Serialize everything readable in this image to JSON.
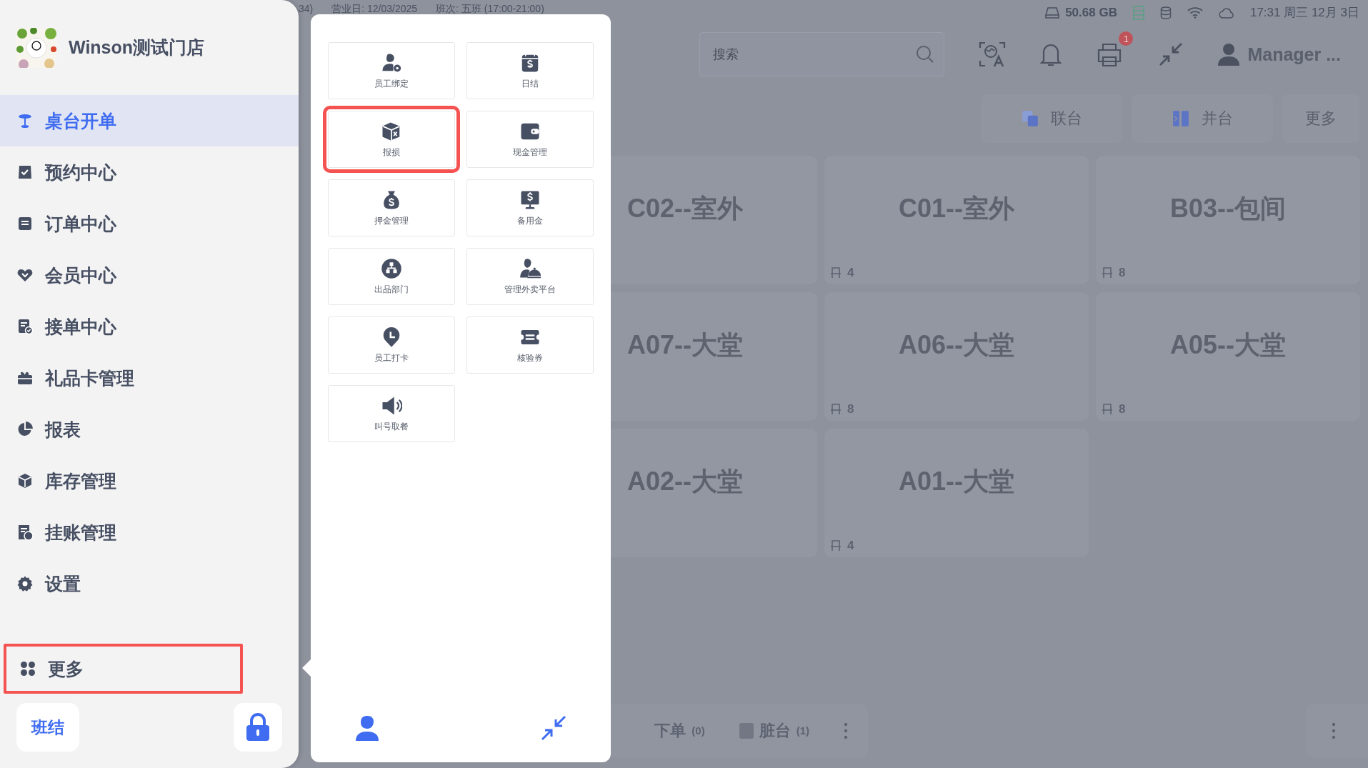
{
  "status_bar": {
    "left_fragment": "34)",
    "business_day": "营业日: 12/03/2025",
    "shift": "班次: 五班 (17:00-21:00)",
    "storage": "50.68 GB",
    "datetime": "17:31 周三 12月 3日"
  },
  "store": {
    "name": "Winson测试门店"
  },
  "sidebar": {
    "items": [
      {
        "label": "桌台开单",
        "selected": true
      },
      {
        "label": "预约中心",
        "selected": false
      },
      {
        "label": "订单中心",
        "selected": false
      },
      {
        "label": "会员中心",
        "selected": false
      },
      {
        "label": "接单中心",
        "selected": false
      },
      {
        "label": "礼品卡管理",
        "selected": false
      },
      {
        "label": "报表",
        "selected": false
      },
      {
        "label": "库存管理",
        "selected": false
      },
      {
        "label": "挂账管理",
        "selected": false
      },
      {
        "label": "设置",
        "selected": false
      }
    ],
    "more": {
      "label": "更多",
      "highlighted": true
    },
    "shift_button": "班结"
  },
  "header": {
    "search": {
      "placeholder": "搜索"
    },
    "notification_count": "1",
    "user": "Manager ..."
  },
  "actions": [
    {
      "label": "联台"
    },
    {
      "label": "并台"
    },
    {
      "label": "更多"
    }
  ],
  "tables": [
    {
      "name": "C02--室外"
    },
    {
      "name": "C01--室外",
      "seats": "4"
    },
    {
      "name": "B03--包间",
      "seats": "8"
    },
    {
      "name": "A07--大堂"
    },
    {
      "name": "A06--大堂",
      "seats": "8"
    },
    {
      "name": "A05--大堂",
      "seats": "8"
    },
    {
      "name": "A02--大堂"
    },
    {
      "name": "A01--大堂",
      "seats": "4"
    }
  ],
  "bottom_bar": {
    "filters": [
      {
        "label": "下单",
        "count": "(0)",
        "kind": "plain"
      },
      {
        "label": "脏台",
        "count": "(1)",
        "kind": "square"
      }
    ]
  },
  "more_panel": {
    "items": [
      {
        "label": "员工绑定",
        "highlighted": false
      },
      {
        "label": "日结",
        "highlighted": false
      },
      {
        "label": "报损",
        "highlighted": true
      },
      {
        "label": "现金管理",
        "highlighted": false
      },
      {
        "label": "押金管理",
        "highlighted": false
      },
      {
        "label": "备用金",
        "highlighted": false
      },
      {
        "label": "出品部门",
        "highlighted": false
      },
      {
        "label": "管理外卖平台",
        "highlighted": false
      },
      {
        "label": "员工打卡",
        "highlighted": false
      },
      {
        "label": "核验券",
        "highlighted": false
      },
      {
        "label": "叫号取餐",
        "highlighted": false
      }
    ]
  }
}
